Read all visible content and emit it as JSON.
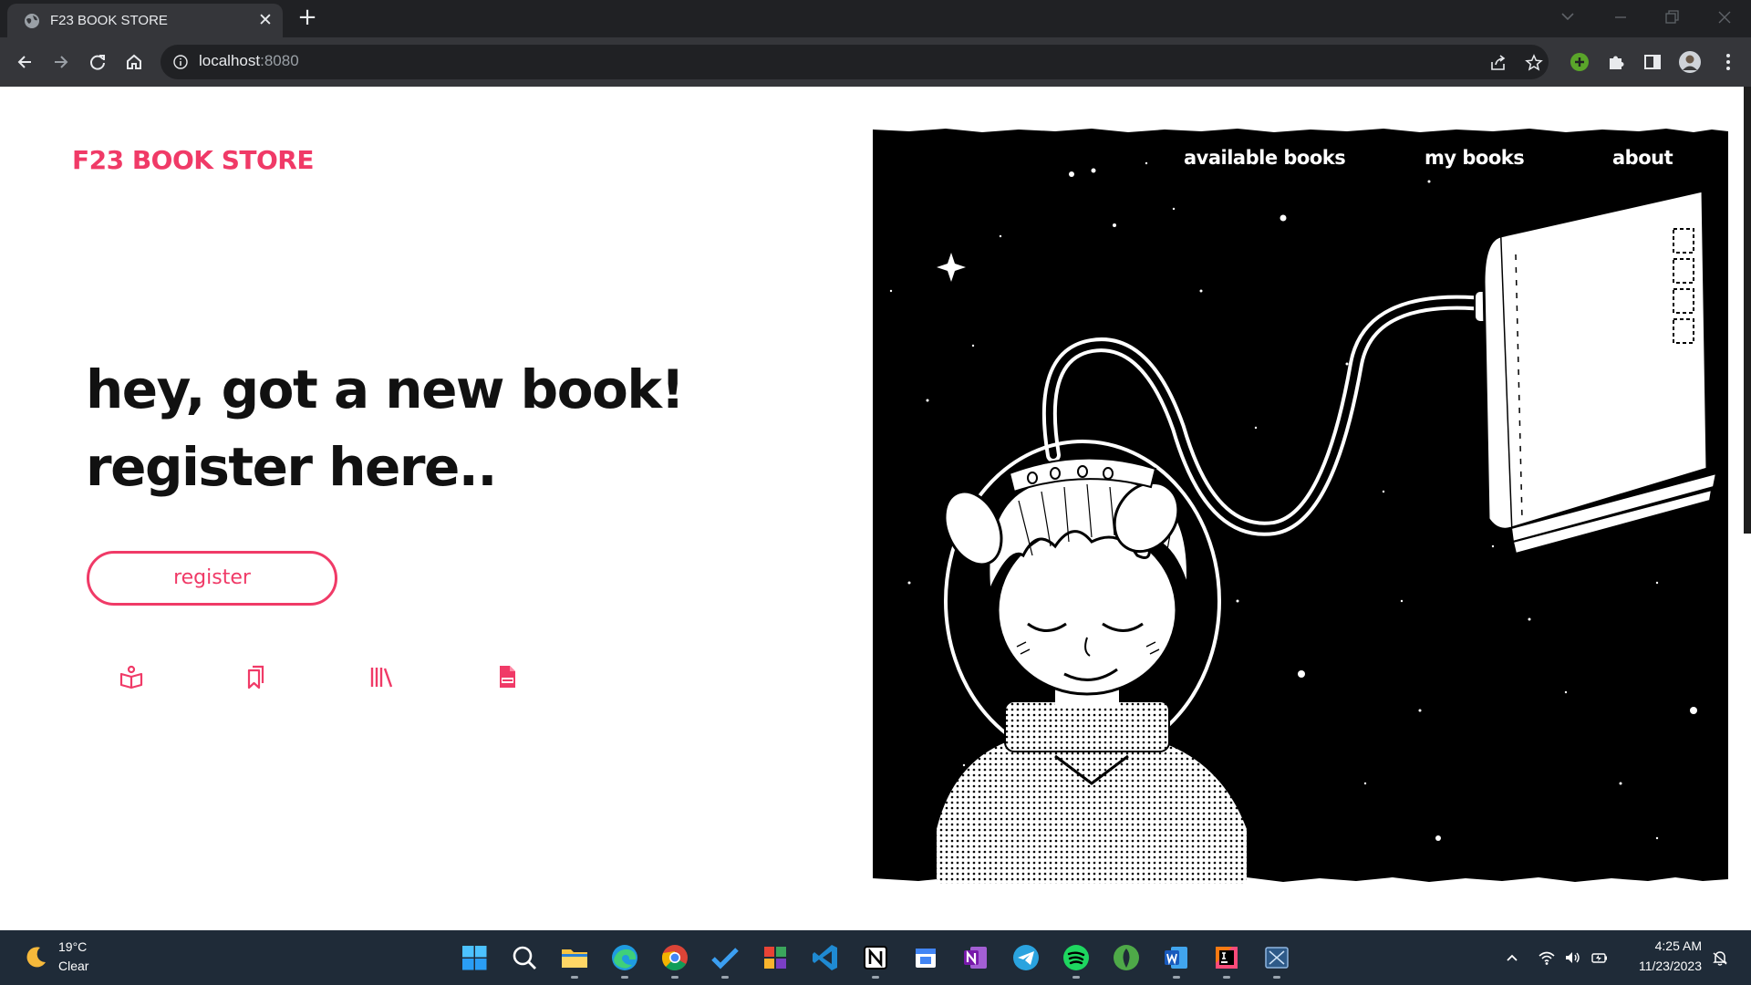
{
  "browser": {
    "tab_title": "F23 BOOK STORE",
    "tab_close": "✕",
    "new_tab": "+",
    "url_host": "localhost",
    "url_port": ":8080"
  },
  "site": {
    "logo": "F23 BOOK STORE",
    "headline_line1": "hey, got a new book!",
    "headline_line2": "register here..",
    "register_label": "register",
    "feature_icons": [
      "open-book-icon",
      "bookmarks-icon",
      "library-icon",
      "pdf-file-icon"
    ],
    "nav": [
      {
        "label": "available books"
      },
      {
        "label": "my books"
      },
      {
        "label": "about"
      }
    ]
  },
  "colors": {
    "accent": "#f03a67",
    "chrome_dark": "#202124",
    "chrome_toolbar": "#35363a",
    "taskbar": "#1f2b38"
  },
  "taskbar": {
    "weather_temp": "19°C",
    "weather_desc": "Clear",
    "apps": [
      "start",
      "search",
      "file-explorer",
      "edge",
      "chrome",
      "todo",
      "office-app",
      "vscode",
      "notion",
      "calendar",
      "onenote",
      "telegram",
      "spotify",
      "mongodb-compass",
      "word",
      "intellij",
      "vm-app"
    ],
    "time": "4:25 AM",
    "date": "11/23/2023"
  }
}
